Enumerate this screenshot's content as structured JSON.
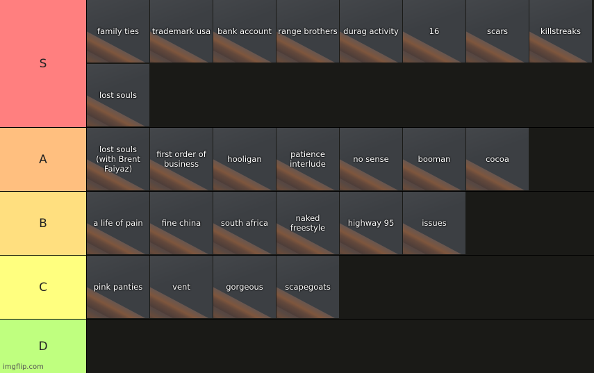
{
  "tiers": [
    {
      "label": "S",
      "color": "#ff7f7f",
      "items": [
        "family ties",
        "trademark usa",
        "bank account",
        "range brothers",
        "durag activity",
        "16",
        "scars",
        "killstreaks",
        "lost souls"
      ]
    },
    {
      "label": "A",
      "color": "#ffbf7f",
      "items": [
        "lost souls (with Brent Faiyaz)",
        "first order of business",
        "hooligan",
        "patience interlude",
        "no sense",
        "booman",
        "cocoa"
      ]
    },
    {
      "label": "B",
      "color": "#ffdf7f",
      "items": [
        "a life of pain",
        "fine china",
        "south africa",
        "naked freestyle",
        "highway 95",
        "issues"
      ]
    },
    {
      "label": "C",
      "color": "#ffff7f",
      "items": [
        "pink panties",
        "vent",
        "gorgeous",
        "scapegoats"
      ]
    },
    {
      "label": "D",
      "color": "#bfff7f",
      "items": []
    }
  ],
  "watermark": "imgflip.com"
}
